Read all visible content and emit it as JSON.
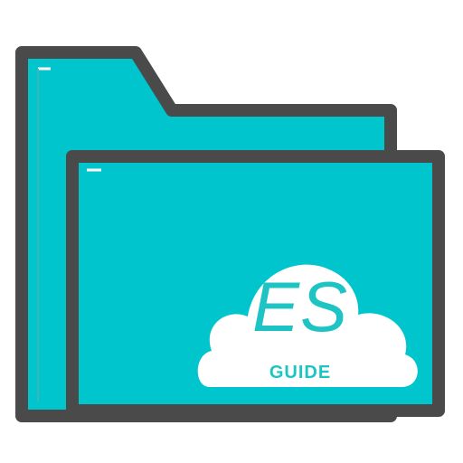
{
  "logo": {
    "title": "ES",
    "subtitle": "GUIDE"
  },
  "icons": {
    "folder": "folder-icon",
    "cloud": "cloud-icon"
  },
  "colors": {
    "folder_fill": "#00c5cc",
    "folder_outline": "#4a4a4a",
    "cloud_fill": "#ffffff",
    "logo_text": "#1ec4c4"
  }
}
